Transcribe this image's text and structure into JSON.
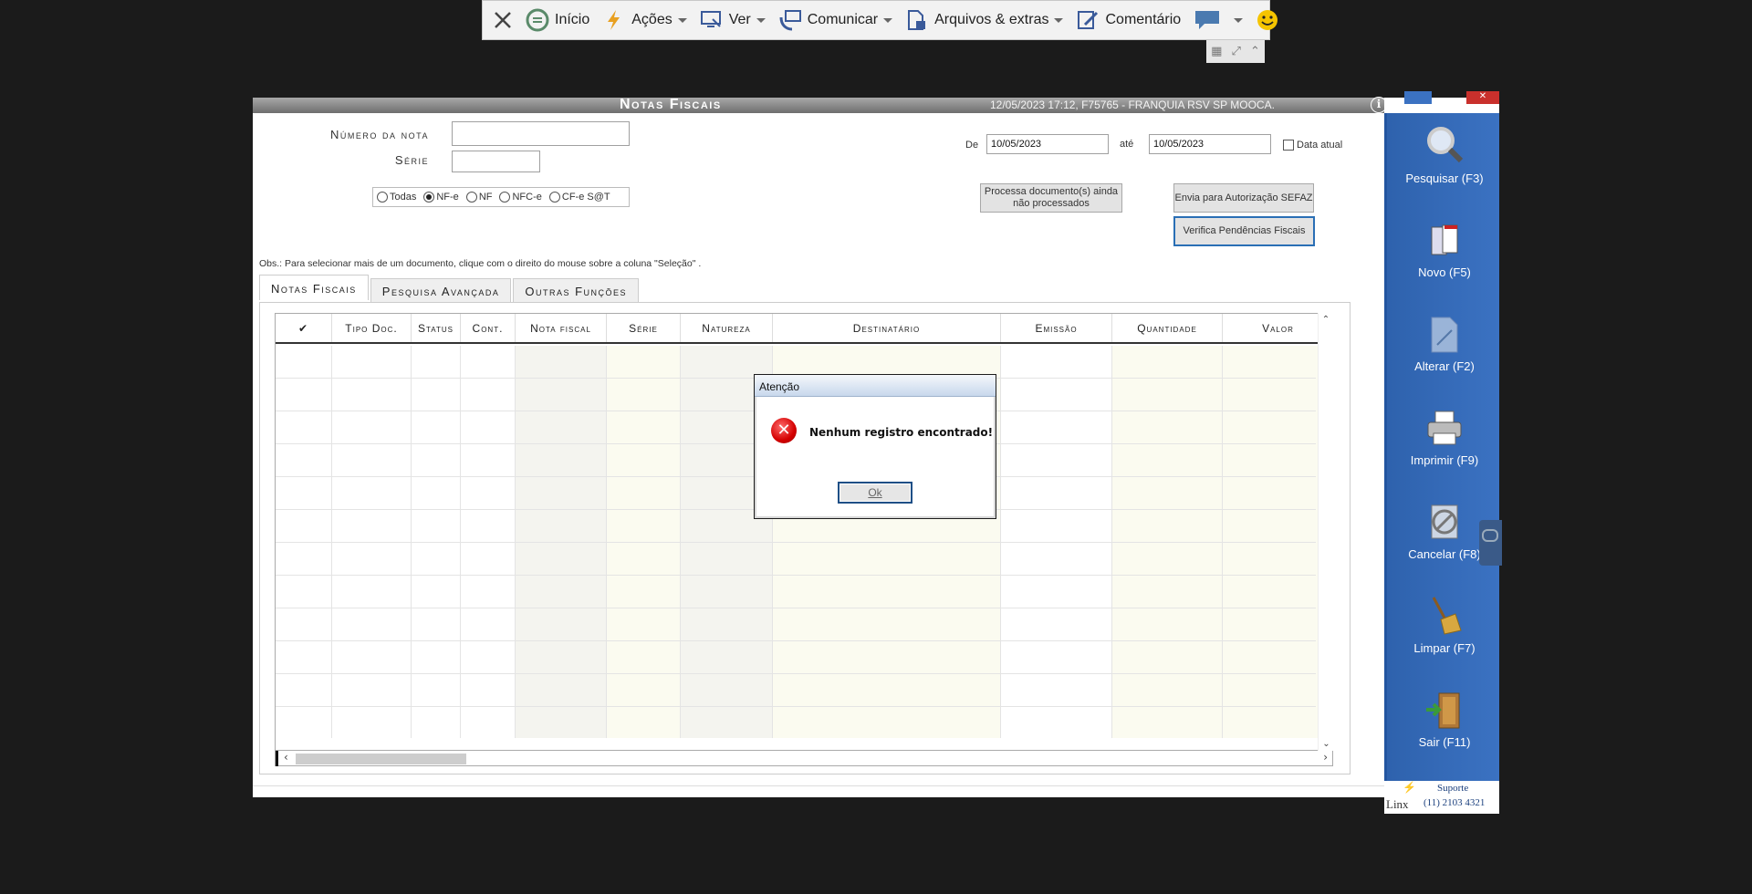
{
  "remote_toolbar": {
    "items": [
      {
        "label": "",
        "icon": "close-icon"
      },
      {
        "label": "Início",
        "icon": "home-icon"
      },
      {
        "label": "Ações",
        "icon": "lightning-icon",
        "dropdown": true
      },
      {
        "label": "Ver",
        "icon": "monitor-icon",
        "dropdown": true
      },
      {
        "label": "Comunicar",
        "icon": "communicate-icon",
        "dropdown": true
      },
      {
        "label": "Arquivos & extras",
        "icon": "files-icon",
        "dropdown": true
      },
      {
        "label": "Comentário",
        "icon": "comment-icon"
      },
      {
        "label": "",
        "icon": "chat-icon",
        "dropdown": true
      },
      {
        "label": "",
        "icon": "smiley-icon"
      }
    ]
  },
  "window": {
    "title": "Notas Fiscais",
    "info": "12/05/2023 17:12, F75765 - FRANQUIA RSV SP MOOCA.",
    "info_icon": "i"
  },
  "form": {
    "numero_label": "Número da nota",
    "numero_value": "",
    "serie_label": "Série",
    "serie_value": "",
    "de_label": "De",
    "de_value": "10/05/2023",
    "ate_label": "até",
    "ate_value": "10/05/2023",
    "data_atual_label": "Data atual",
    "doc_types": [
      "Todas",
      "NF-e",
      "NF",
      "NFC-e",
      "CF-e S@T"
    ],
    "doc_type_selected": "NF-e",
    "btn_processa": "Processa documento(s) ainda não processados",
    "btn_envia": "Envia para Autorização SEFAZ",
    "btn_verifica": "Verifica Pendências Fiscais",
    "obs": "Obs.: Para selecionar mais de um documento, clique com o direito do mouse sobre a coluna \"Seleção\" ."
  },
  "tabs": [
    "Notas Fiscais",
    "Pesquisa Avançada",
    "Outras Funções"
  ],
  "active_tab": "Notas Fiscais",
  "grid": {
    "columns": [
      "✔",
      "Tipo Doc.",
      "Status",
      "Cont.",
      "Nota fiscal",
      "Série",
      "Natureza",
      "Destinatário",
      "Emissão",
      "Quantidade",
      "Valor",
      ""
    ]
  },
  "sidebar": {
    "buttons": [
      {
        "label": "Pesquisar (F3)",
        "icon": "magnifier-icon"
      },
      {
        "label": "Novo (F5)",
        "icon": "new-doc-icon"
      },
      {
        "label": "Alterar (F2)",
        "icon": "edit-doc-icon"
      },
      {
        "label": "Imprimir (F9)",
        "icon": "printer-icon"
      },
      {
        "label": "Cancelar (F8)",
        "icon": "cancel-icon"
      },
      {
        "label": "Limpar (F7)",
        "icon": "broom-icon"
      },
      {
        "label": "Sair (F11)",
        "icon": "exit-door-icon"
      }
    ],
    "support_title": "Suporte",
    "support_phone": "(11) 2103 4321",
    "logo": "Linx"
  },
  "dialog": {
    "title": "Atenção",
    "message": "Nenhum registro encontrado!",
    "ok": "Ok"
  }
}
